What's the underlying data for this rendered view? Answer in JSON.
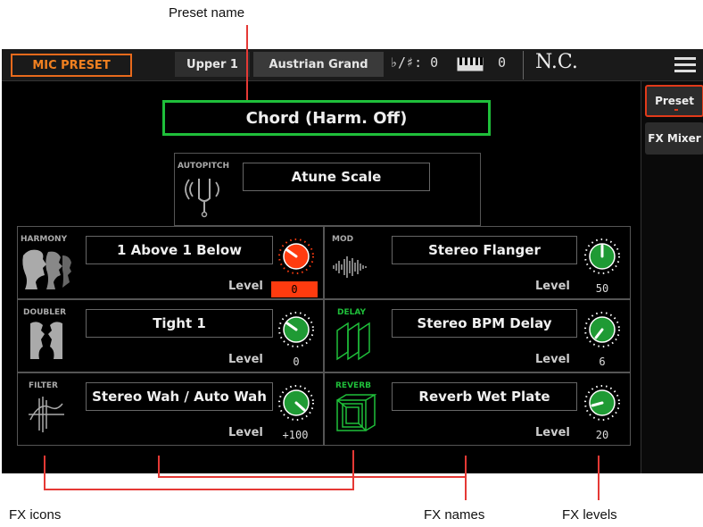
{
  "callouts": {
    "preset_name": "Preset name",
    "fx_icons": "FX icons",
    "fx_names": "FX names",
    "fx_levels": "FX levels"
  },
  "topbar": {
    "mode": "MIC PRESET",
    "keyboard_part": "Upper 1",
    "sound": "Austrian Grand",
    "transpose_label": "♭/♯: 0",
    "octave_value": "0",
    "chord": "N.C."
  },
  "sidebar": {
    "tabs": [
      {
        "label": "Preset",
        "selected": true
      },
      {
        "label": "FX Mixer",
        "selected": false
      }
    ]
  },
  "preset": {
    "name": "Chord (Harm. Off)"
  },
  "autopitch": {
    "label": "AUTOPITCH",
    "scale": "Atune Scale"
  },
  "fx": [
    {
      "section": "HARMONY",
      "name": "1 Above 1 Below",
      "level_label": "Level",
      "level": "0",
      "selected": true,
      "icon": "harmony-faces-icon"
    },
    {
      "section": "MOD",
      "name": "Stereo Flanger",
      "level_label": "Level",
      "level": "50",
      "icon": "waveform-icon"
    },
    {
      "section": "DOUBLER",
      "name": "Tight 1",
      "level_label": "Level",
      "level": "0",
      "icon": "doubler-faces-icon"
    },
    {
      "section": "DELAY",
      "name": "Stereo BPM Delay",
      "level_label": "Level",
      "level": "6",
      "icon": "delay-panels-icon"
    },
    {
      "section": "FILTER",
      "name": "Stereo Wah / Auto Wah",
      "level_label": "Level",
      "level": "+100",
      "icon": "filter-icon"
    },
    {
      "section": "REVERB",
      "name": "Reverb Wet Plate",
      "level_label": "Level",
      "level": "20",
      "icon": "reverb-cube-icon"
    }
  ],
  "colors": {
    "accent_orange": "#f08020",
    "preset_frame": "#1fbf3a",
    "active_green": "#1fbf3a",
    "knob_selected": "#ff3b0f",
    "callout_line": "#e53935"
  }
}
